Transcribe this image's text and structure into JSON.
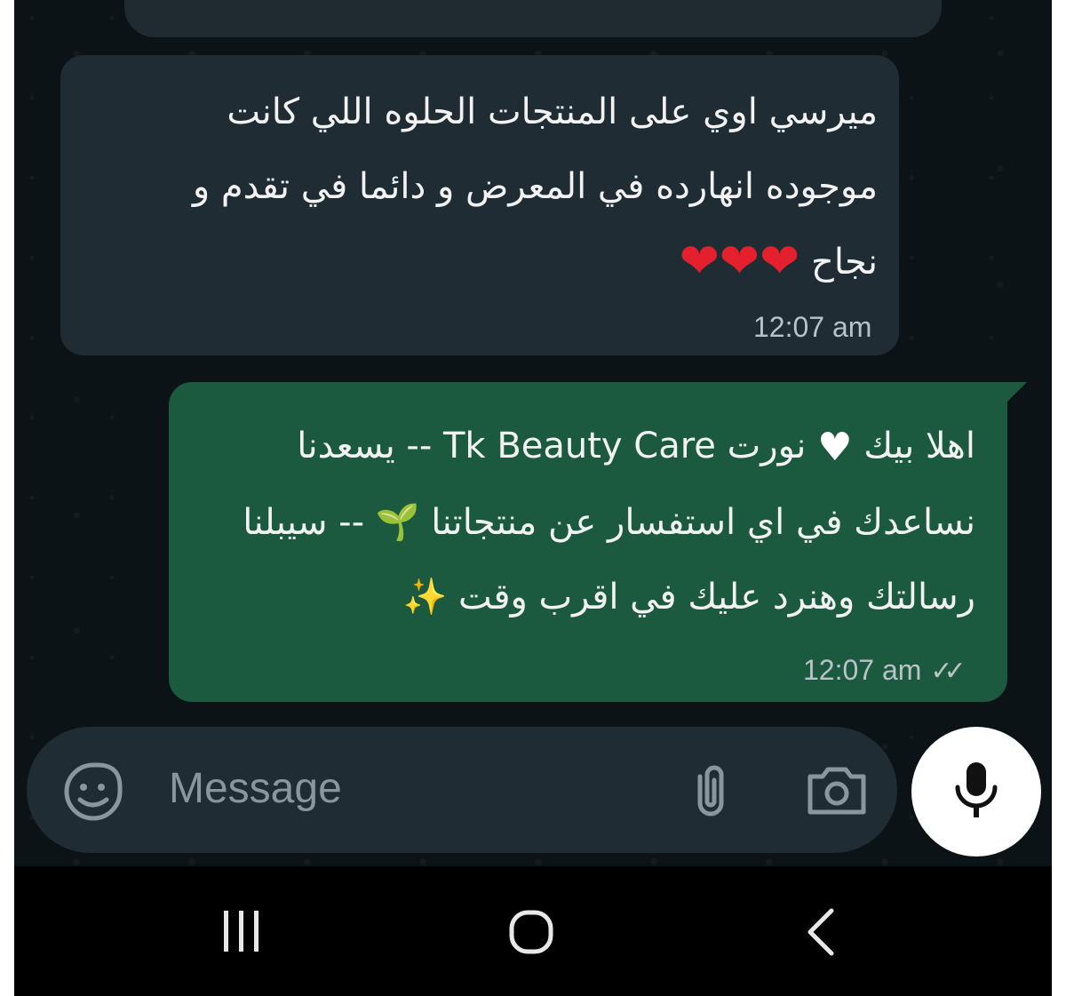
{
  "conversation": {
    "incoming": {
      "lines": [
        "ميرسي اوي على المنتجات الحلوه اللي كانت",
        "موجوده انهارده في المعرض و دائما في تقدم و",
        "نجاح"
      ],
      "emoji": "❤❤❤",
      "time": "12:07 am"
    },
    "outgoing": {
      "line1_a": "اهلا بيك",
      "line1_b": "نورت Tk Beauty Care -- يسعدنا",
      "line2_a": "نساعدك في اي استفسار عن منتجاتنا",
      "line2_b": "-- سيبلنا",
      "line3": "رسالتك وهنرد عليك في اقرب وقت",
      "emoji_heart": "♥",
      "emoji_sprout": "🌱",
      "emoji_sparkles": "✨",
      "time": "12:07 am",
      "status_ticks": "✓✓"
    }
  },
  "composer": {
    "placeholder": "Message",
    "icons": [
      "sticker-icon",
      "attach-icon",
      "camera-icon",
      "mic-icon"
    ]
  },
  "system_nav": {
    "icons": [
      "recents-icon",
      "home-icon",
      "back-icon"
    ]
  },
  "colors": {
    "chat_bg": "#0c1317",
    "incoming_bubble": "#1f2c33",
    "outgoing_bubble": "#1b5a3f",
    "navbar": "#000000"
  }
}
